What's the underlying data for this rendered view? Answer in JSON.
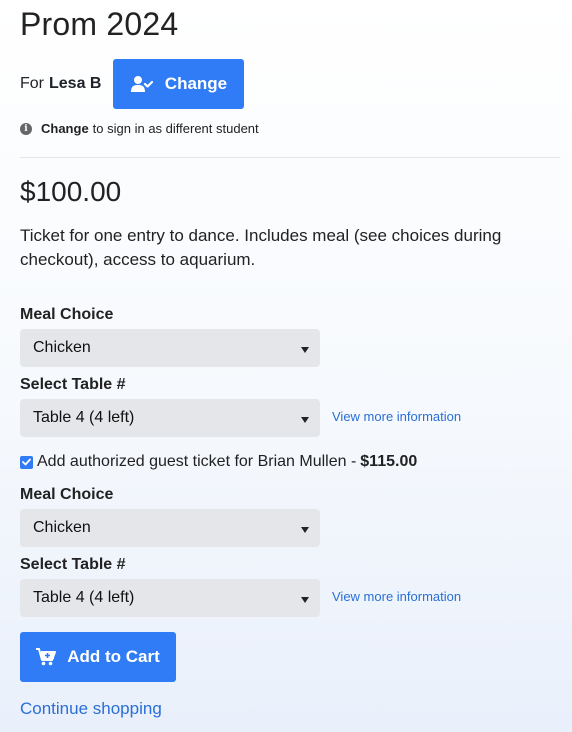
{
  "event": {
    "title": "Prom 2024"
  },
  "student": {
    "for_label": "For",
    "name": "Lesa B",
    "change_label": "Change"
  },
  "hint": {
    "bold": "Change",
    "text": "to sign in as different student"
  },
  "ticket": {
    "price": "$100.00",
    "description": "Ticket for one entry to dance. Includes meal (see choices during checkout), access to aquarium."
  },
  "main_ticket": {
    "meal_label": "Meal Choice",
    "meal_value": "Chicken",
    "table_label": "Select Table #",
    "table_value": "Table 4 (4 left)",
    "more_info": "View more information"
  },
  "guest": {
    "checked": true,
    "label": "Add authorized guest ticket for Brian Mullen -",
    "price": "$115.00",
    "meal_label": "Meal Choice",
    "meal_value": "Chicken",
    "table_label": "Select Table #",
    "table_value": "Table 4 (4 left)",
    "more_info": "View more information"
  },
  "actions": {
    "add_to_cart": "Add to Cart",
    "continue_shopping": "Continue shopping"
  },
  "colors": {
    "primary": "#2f7cf6",
    "link": "#2a6fd6",
    "select_bg": "#e4e6ea"
  },
  "icons": {
    "change": "user-check-icon",
    "cart": "cart-plus-icon",
    "hint": "info-icon"
  }
}
